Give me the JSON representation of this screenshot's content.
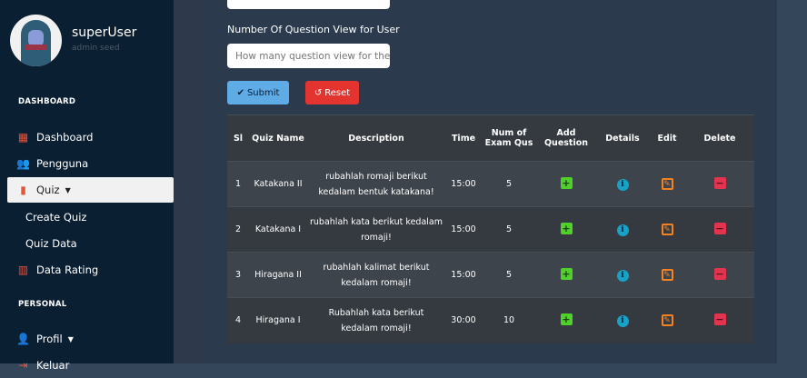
{
  "user": {
    "name": "superUser",
    "role": "admin seed"
  },
  "sidebar": {
    "section_dashboard": "DASHBOARD",
    "section_personal": "PERSONAL",
    "items": [
      {
        "label": "Dashboard",
        "icon": "grid-icon"
      },
      {
        "label": "Pengguna",
        "icon": "users-icon"
      },
      {
        "label": "Quiz",
        "icon": "book-icon"
      },
      {
        "label": "Create Quiz"
      },
      {
        "label": "Quiz Data"
      },
      {
        "label": "Data Rating",
        "icon": "bar-chart-icon"
      },
      {
        "label": "Profil",
        "icon": "user-cog-icon"
      },
      {
        "label": "Keluar",
        "icon": "logout-icon"
      }
    ]
  },
  "form": {
    "label": "Number Of Question View for User",
    "placeholder": "How many question view for the user",
    "submit": "Submit",
    "reset": "Reset"
  },
  "table": {
    "headers": [
      "Sl",
      "Quiz Name",
      "Description",
      "Time",
      "Num of Exam Qus",
      "Add Question",
      "Details",
      "Edit",
      "Delete"
    ],
    "rows": [
      {
        "sl": "1",
        "name": "Katakana II",
        "desc": "rubahlah romaji berikut kedalam bentuk katakana!",
        "time": "15:00",
        "num": "5"
      },
      {
        "sl": "2",
        "name": "Katakana I",
        "desc": "rubahlah kata berikut kedalam romaji!",
        "time": "15:00",
        "num": "5"
      },
      {
        "sl": "3",
        "name": "Hiragana II",
        "desc": "rubahlah kalimat berikut kedalam romaji!",
        "time": "15:00",
        "num": "5"
      },
      {
        "sl": "4",
        "name": "Hiragana I",
        "desc": "Rubahlah kata berikut kedalam romaji!",
        "time": "30:00",
        "num": "10"
      }
    ]
  }
}
